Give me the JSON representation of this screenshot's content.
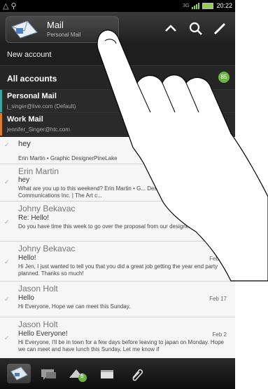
{
  "status_bar": {
    "time": "20:22",
    "network": "3G"
  },
  "header": {
    "title": "Mail",
    "subtitle": "Personal Mail"
  },
  "dropdown": {
    "new_account": "New account",
    "all_accounts": "All accounts",
    "all_accounts_badge": "85",
    "accounts": [
      {
        "name": "Personal Mail",
        "email": "j_singer@live.com (Default)",
        "color": "#3ea6a0"
      },
      {
        "name": "Work Mail",
        "email": "jennifer_Singer@htc.com",
        "color": "#e07b2b"
      }
    ]
  },
  "messages": [
    {
      "from": "hey",
      "subject": "",
      "preview": "Erin Martin • Graphic DesignerPineLake",
      "date": ""
    },
    {
      "from": "Erin Martin",
      "subject": "hey",
      "preview": "What are you up to this weekend? Erin Martin • G... DesignerPineLake Communications Inc. | The Art c...",
      "date": ""
    },
    {
      "from": "Johny Bekavac",
      "subject": "Re: Hello!",
      "preview": "Do you have time this week to go over the proposal from our designer?",
      "date": ""
    },
    {
      "from": "Johny Bekavac",
      "subject": "Hello!",
      "preview": "Hi Jen, I just wanted to tell you that you did a great job getting the year end party planned. Thanks so much!",
      "date": "Feb 21"
    },
    {
      "from": "Jason Holt",
      "subject": "Hello",
      "preview": "Hi Everyone, Hope we can meet this Sunday.",
      "date": "Feb 17"
    },
    {
      "from": "Jason Holt",
      "subject": "Hello Everyone!",
      "preview": "Hi Everyone, I'll be in town for a few days before leaving to japan on Monday. Hope we can meet and have lunch this Sunday. Let me know if",
      "date": "Feb 2"
    }
  ],
  "bottom_tabs": [
    {
      "icon": "inbox-icon"
    },
    {
      "icon": "conversations-icon"
    },
    {
      "icon": "group-icon",
      "badge": "5"
    },
    {
      "icon": "folders-icon"
    },
    {
      "icon": "attachment-icon"
    }
  ]
}
